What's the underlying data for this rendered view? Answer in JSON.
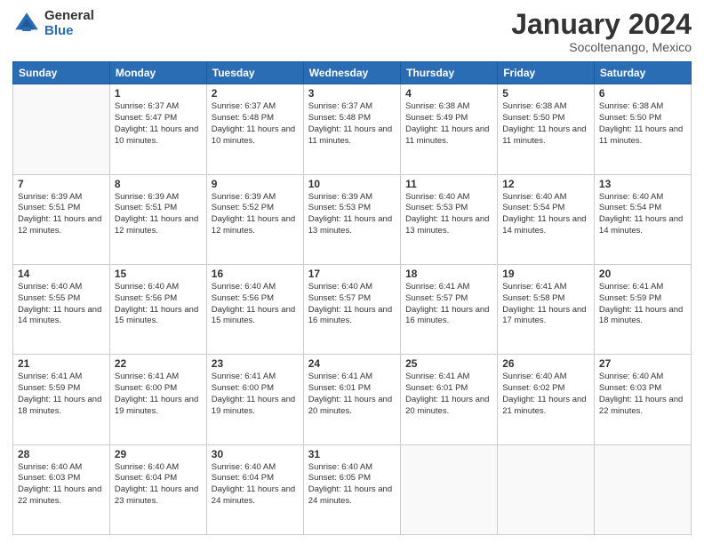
{
  "logo": {
    "general": "General",
    "blue": "Blue"
  },
  "title": "January 2024",
  "subtitle": "Socoltenango, Mexico",
  "days_header": [
    "Sunday",
    "Monday",
    "Tuesday",
    "Wednesday",
    "Thursday",
    "Friday",
    "Saturday"
  ],
  "weeks": [
    [
      {
        "day": "",
        "info": ""
      },
      {
        "day": "1",
        "info": "Sunrise: 6:37 AM\nSunset: 5:47 PM\nDaylight: 11 hours\nand 10 minutes."
      },
      {
        "day": "2",
        "info": "Sunrise: 6:37 AM\nSunset: 5:48 PM\nDaylight: 11 hours\nand 10 minutes."
      },
      {
        "day": "3",
        "info": "Sunrise: 6:37 AM\nSunset: 5:48 PM\nDaylight: 11 hours\nand 11 minutes."
      },
      {
        "day": "4",
        "info": "Sunrise: 6:38 AM\nSunset: 5:49 PM\nDaylight: 11 hours\nand 11 minutes."
      },
      {
        "day": "5",
        "info": "Sunrise: 6:38 AM\nSunset: 5:50 PM\nDaylight: 11 hours\nand 11 minutes."
      },
      {
        "day": "6",
        "info": "Sunrise: 6:38 AM\nSunset: 5:50 PM\nDaylight: 11 hours\nand 11 minutes."
      }
    ],
    [
      {
        "day": "7",
        "info": "Sunrise: 6:39 AM\nSunset: 5:51 PM\nDaylight: 11 hours\nand 12 minutes."
      },
      {
        "day": "8",
        "info": "Sunrise: 6:39 AM\nSunset: 5:51 PM\nDaylight: 11 hours\nand 12 minutes."
      },
      {
        "day": "9",
        "info": "Sunrise: 6:39 AM\nSunset: 5:52 PM\nDaylight: 11 hours\nand 12 minutes."
      },
      {
        "day": "10",
        "info": "Sunrise: 6:39 AM\nSunset: 5:53 PM\nDaylight: 11 hours\nand 13 minutes."
      },
      {
        "day": "11",
        "info": "Sunrise: 6:40 AM\nSunset: 5:53 PM\nDaylight: 11 hours\nand 13 minutes."
      },
      {
        "day": "12",
        "info": "Sunrise: 6:40 AM\nSunset: 5:54 PM\nDaylight: 11 hours\nand 14 minutes."
      },
      {
        "day": "13",
        "info": "Sunrise: 6:40 AM\nSunset: 5:54 PM\nDaylight: 11 hours\nand 14 minutes."
      }
    ],
    [
      {
        "day": "14",
        "info": "Sunrise: 6:40 AM\nSunset: 5:55 PM\nDaylight: 11 hours\nand 14 minutes."
      },
      {
        "day": "15",
        "info": "Sunrise: 6:40 AM\nSunset: 5:56 PM\nDaylight: 11 hours\nand 15 minutes."
      },
      {
        "day": "16",
        "info": "Sunrise: 6:40 AM\nSunset: 5:56 PM\nDaylight: 11 hours\nand 15 minutes."
      },
      {
        "day": "17",
        "info": "Sunrise: 6:40 AM\nSunset: 5:57 PM\nDaylight: 11 hours\nand 16 minutes."
      },
      {
        "day": "18",
        "info": "Sunrise: 6:41 AM\nSunset: 5:57 PM\nDaylight: 11 hours\nand 16 minutes."
      },
      {
        "day": "19",
        "info": "Sunrise: 6:41 AM\nSunset: 5:58 PM\nDaylight: 11 hours\nand 17 minutes."
      },
      {
        "day": "20",
        "info": "Sunrise: 6:41 AM\nSunset: 5:59 PM\nDaylight: 11 hours\nand 18 minutes."
      }
    ],
    [
      {
        "day": "21",
        "info": "Sunrise: 6:41 AM\nSunset: 5:59 PM\nDaylight: 11 hours\nand 18 minutes."
      },
      {
        "day": "22",
        "info": "Sunrise: 6:41 AM\nSunset: 6:00 PM\nDaylight: 11 hours\nand 19 minutes."
      },
      {
        "day": "23",
        "info": "Sunrise: 6:41 AM\nSunset: 6:00 PM\nDaylight: 11 hours\nand 19 minutes."
      },
      {
        "day": "24",
        "info": "Sunrise: 6:41 AM\nSunset: 6:01 PM\nDaylight: 11 hours\nand 20 minutes."
      },
      {
        "day": "25",
        "info": "Sunrise: 6:41 AM\nSunset: 6:01 PM\nDaylight: 11 hours\nand 20 minutes."
      },
      {
        "day": "26",
        "info": "Sunrise: 6:40 AM\nSunset: 6:02 PM\nDaylight: 11 hours\nand 21 minutes."
      },
      {
        "day": "27",
        "info": "Sunrise: 6:40 AM\nSunset: 6:03 PM\nDaylight: 11 hours\nand 22 minutes."
      }
    ],
    [
      {
        "day": "28",
        "info": "Sunrise: 6:40 AM\nSunset: 6:03 PM\nDaylight: 11 hours\nand 22 minutes."
      },
      {
        "day": "29",
        "info": "Sunrise: 6:40 AM\nSunset: 6:04 PM\nDaylight: 11 hours\nand 23 minutes."
      },
      {
        "day": "30",
        "info": "Sunrise: 6:40 AM\nSunset: 6:04 PM\nDaylight: 11 hours\nand 24 minutes."
      },
      {
        "day": "31",
        "info": "Sunrise: 6:40 AM\nSunset: 6:05 PM\nDaylight: 11 hours\nand 24 minutes."
      },
      {
        "day": "",
        "info": ""
      },
      {
        "day": "",
        "info": ""
      },
      {
        "day": "",
        "info": ""
      }
    ]
  ]
}
